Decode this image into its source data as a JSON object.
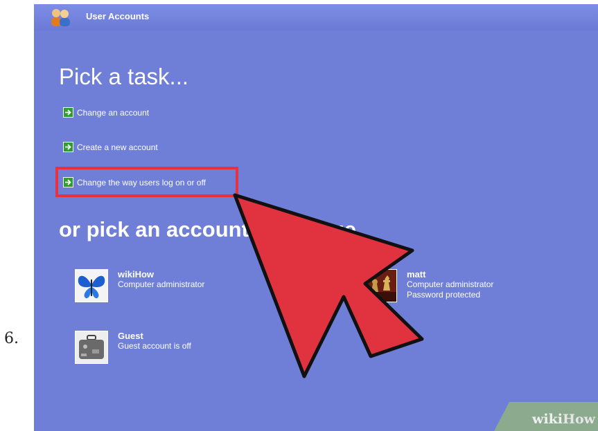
{
  "step_number": "6.",
  "window": {
    "title": "User Accounts"
  },
  "headings": {
    "task": "Pick a task...",
    "account": "or pick an account to change"
  },
  "tasks": [
    {
      "label": "Change an account"
    },
    {
      "label": "Create a new account"
    },
    {
      "label": "Change the way users log on or off"
    }
  ],
  "accounts": [
    {
      "name": "wikiHow",
      "lines": [
        "Computer administrator"
      ],
      "picture": "butterfly-icon"
    },
    {
      "name": "Guest",
      "lines": [
        "Guest account is off"
      ],
      "picture": "suitcase-icon"
    },
    {
      "name": "matt",
      "lines": [
        "Computer administrator",
        "Password protected"
      ],
      "picture": "chess-icon"
    }
  ],
  "annotation": {
    "highlight_color": "#e8303f",
    "arrow_color": "#e0323f"
  },
  "watermark": {
    "brand1": "wiki",
    "brand2": "How"
  },
  "colors": {
    "background": "#6f7fd8",
    "task_icon": "#2e9c2e"
  }
}
